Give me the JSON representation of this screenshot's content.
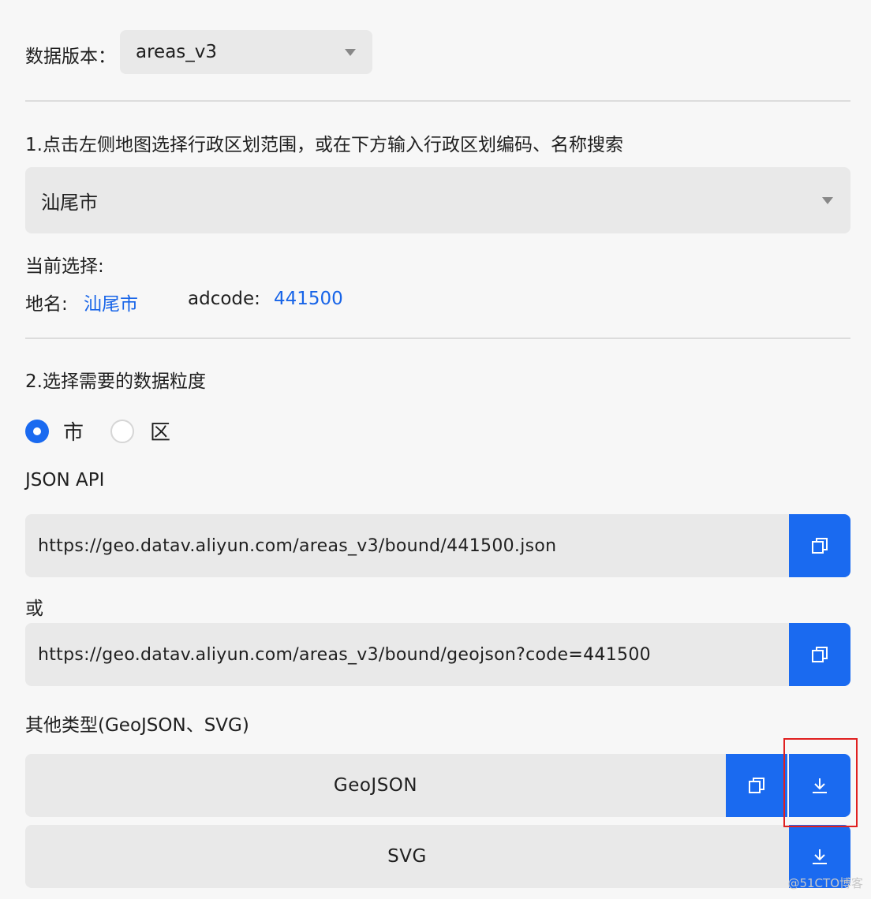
{
  "version": {
    "label": "数据版本：",
    "selected": "areas_v3"
  },
  "step1": {
    "instruction": "1.点击左侧地图选择行政区划范围，或在下方输入行政区划编码、名称搜索",
    "selected_region": "汕尾市"
  },
  "current": {
    "heading": "当前选择:",
    "name_label": "地名:",
    "name_value": "汕尾市",
    "adcode_label": "adcode:",
    "adcode_value": "441500"
  },
  "step2": {
    "instruction": "2.选择需要的数据粒度",
    "options": [
      {
        "label": "市",
        "checked": true
      },
      {
        "label": "区",
        "checked": false
      }
    ]
  },
  "json_api": {
    "label": "JSON API",
    "url1": "https://geo.datav.aliyun.com/areas_v3/bound/441500.json",
    "or_label": "或",
    "url2": "https://geo.datav.aliyun.com/areas_v3/bound/geojson?code=441500"
  },
  "other_types": {
    "label": "其他类型(GeoJSON、SVG)",
    "items": [
      {
        "name": "GeoJSON"
      },
      {
        "name": "SVG"
      }
    ]
  },
  "icons": {
    "copy": "copy-icon",
    "download": "download-icon",
    "dropdown": "chevron-down-icon"
  },
  "colors": {
    "accent": "#1a6af0",
    "link": "#1764e8",
    "highlight": "#e02020"
  },
  "watermark": "@51CTO博客"
}
